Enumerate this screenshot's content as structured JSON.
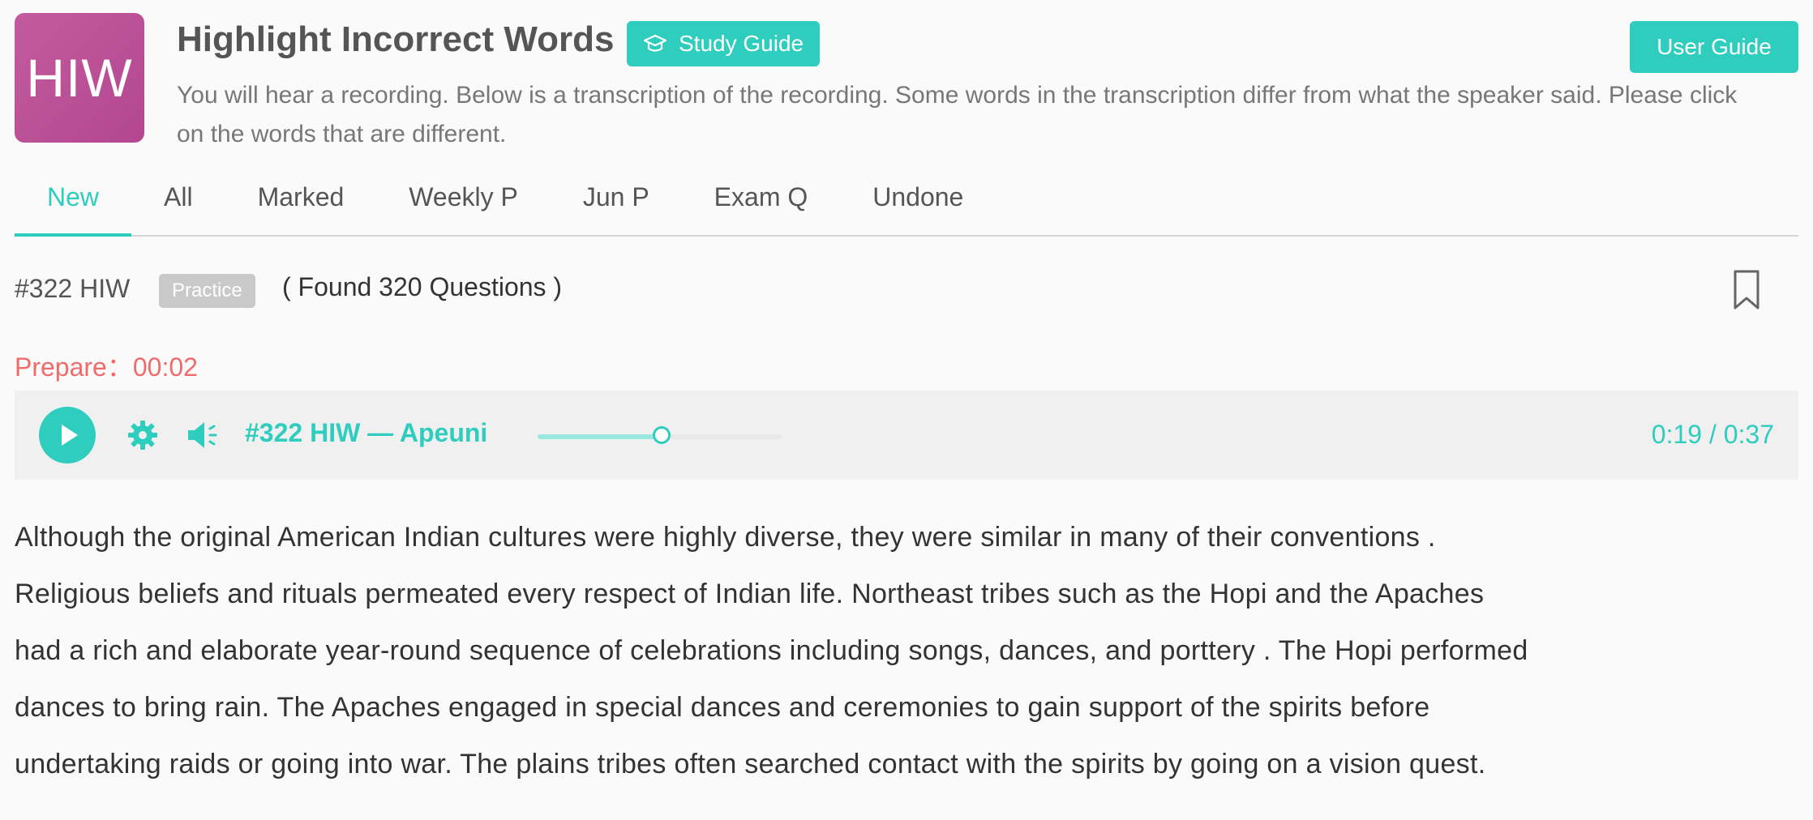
{
  "header": {
    "logo_text": "HIW",
    "title": "Highlight Incorrect Words",
    "study_guide_label": "Study Guide",
    "user_guide_label": "User Guide",
    "instructions": "You will hear a recording. Below is a transcription of the recording. Some words in the transcription differ from what the speaker said. Please click on the words that are different."
  },
  "tabs": [
    {
      "label": "New",
      "active": true
    },
    {
      "label": "All"
    },
    {
      "label": "Marked"
    },
    {
      "label": "Weekly P"
    },
    {
      "label": "Jun P"
    },
    {
      "label": "Exam Q"
    },
    {
      "label": "Undone"
    }
  ],
  "question": {
    "id": "#322 HIW",
    "badge": "Practice",
    "found": "( Found 320 Questions )"
  },
  "prepare": "Prepare：00:02",
  "player": {
    "title": "#322 HIW — Apeuni",
    "time": "0:19 / 0:37",
    "progress": 0.51
  },
  "passage_lines": [
    "Although the original American Indian cultures were highly diverse, they were similar in many of their conventions .",
    "Religious beliefs and rituals permeated every respect of Indian life. Northeast tribes such as the Hopi and the Apaches",
    "had a rich and elaborate year-round sequence of celebrations including songs, dances, and porttery . The Hopi performed",
    "dances to bring rain. The Apaches engaged in special dances and ceremonies to gain support of the spirits before",
    "undertaking raids or going into war. The plains tribes often searched contact with the spirits by going on a vision quest."
  ],
  "colors": {
    "accent": "#2fcdbe",
    "logo": "#bd519a",
    "prepare": "#f06b6b",
    "badge": "#c9c9c9"
  },
  "icons": [
    "graduation-cap-icon",
    "bookmark-icon",
    "play-icon",
    "gear-icon",
    "speaker-icon"
  ]
}
